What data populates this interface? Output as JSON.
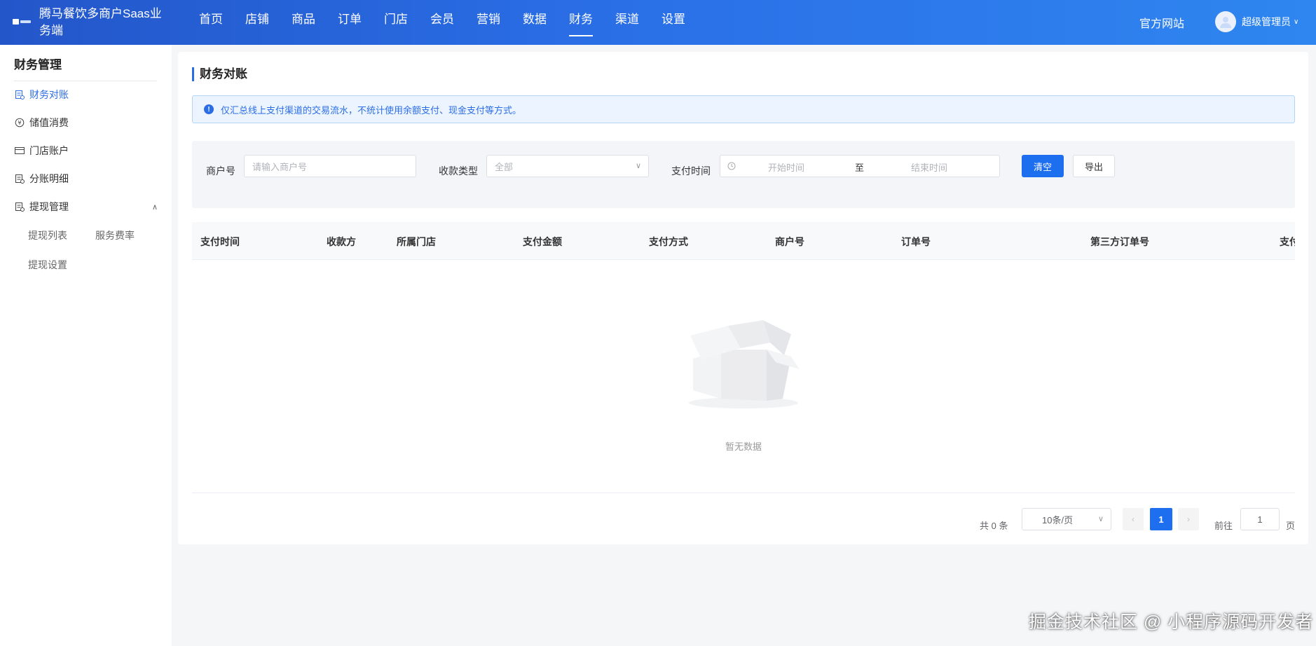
{
  "header": {
    "brand_title": "腾马餐饮多商户Saas业务端",
    "nav": [
      {
        "label": "首页"
      },
      {
        "label": "店铺"
      },
      {
        "label": "商品"
      },
      {
        "label": "订单"
      },
      {
        "label": "门店"
      },
      {
        "label": "会员"
      },
      {
        "label": "营销"
      },
      {
        "label": "数据"
      },
      {
        "label": "财务",
        "active": true
      },
      {
        "label": "渠道"
      },
      {
        "label": "设置"
      }
    ],
    "official_site": "官方网站",
    "user_name": "超级管理员"
  },
  "sidebar": {
    "title": "财务管理",
    "items": [
      {
        "label": "财务对账",
        "icon": "ledger-icon",
        "active": true
      },
      {
        "label": "储值消费",
        "icon": "yen-icon"
      },
      {
        "label": "门店账户",
        "icon": "card-icon"
      },
      {
        "label": "分账明细",
        "icon": "ledger-icon"
      },
      {
        "label": "提现管理",
        "icon": "ledger-icon",
        "expanded": true
      }
    ],
    "sub_items": [
      {
        "label": "提现列表"
      },
      {
        "label": "服务费率"
      },
      {
        "label": "提现设置"
      }
    ]
  },
  "main": {
    "page_title": "财务对账",
    "notice": "仅汇总线上支付渠道的交易流水，不统计使用余额支付、现金支付等方式。",
    "filters": {
      "merchant_label": "商户号",
      "merchant_placeholder": "请输入商户号",
      "type_label": "收款类型",
      "type_value": "全部",
      "time_label": "支付时间",
      "start_placeholder": "开始时间",
      "separator": "至",
      "end_placeholder": "结束时间",
      "clear_label": "清空",
      "export_label": "导出"
    },
    "table": {
      "columns": [
        "支付时间",
        "收款方",
        "所属门店",
        "支付金额",
        "支付方式",
        "商户号",
        "订单号",
        "第三方订单号",
        "支付"
      ],
      "rows": [],
      "empty_text": "暂无数据"
    },
    "pagination": {
      "total_text": "共 0 条",
      "page_size": "10条/页",
      "current_page": "1",
      "goto_label": "前往",
      "goto_value": "1",
      "page_unit": "页"
    }
  },
  "watermark": "掘金技术社区 @ 小程序源码开发者",
  "colors": {
    "primary": "#1e6ff0",
    "header_start": "#2356c9",
    "header_end": "#2f86f0",
    "notice_bg": "#ecf5ff"
  }
}
